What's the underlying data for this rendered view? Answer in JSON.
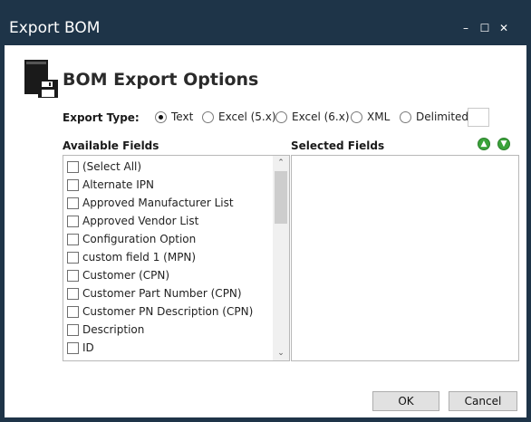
{
  "window": {
    "title": "Export BOM",
    "controls": {
      "minimize": "–",
      "maximize": "☐",
      "close": "✕"
    }
  },
  "header": {
    "title": "BOM Export Options",
    "icon": "book-save-icon"
  },
  "export_type": {
    "label": "Export Type:",
    "options": [
      "Text",
      "Excel (5.x)",
      "Excel (6.x)",
      "XML",
      "Delimited"
    ],
    "selected": "Text",
    "delimiter_value": ""
  },
  "available_fields": {
    "label": "Available Fields",
    "items": [
      "(Select All)",
      "Alternate IPN",
      "Approved Manufacturer List",
      "Approved Vendor List",
      "Configuration Option",
      "custom field 1 (MPN)",
      "Customer (CPN)",
      "Customer Part Number (CPN)",
      "Customer PN Description (CPN)",
      "Description",
      "ID"
    ]
  },
  "selected_fields": {
    "label": "Selected Fields",
    "items": []
  },
  "buttons": {
    "ok": "OK",
    "cancel": "Cancel"
  },
  "colors": {
    "titlebar": "#1e3448",
    "arrow_green": "#3aa33a"
  }
}
